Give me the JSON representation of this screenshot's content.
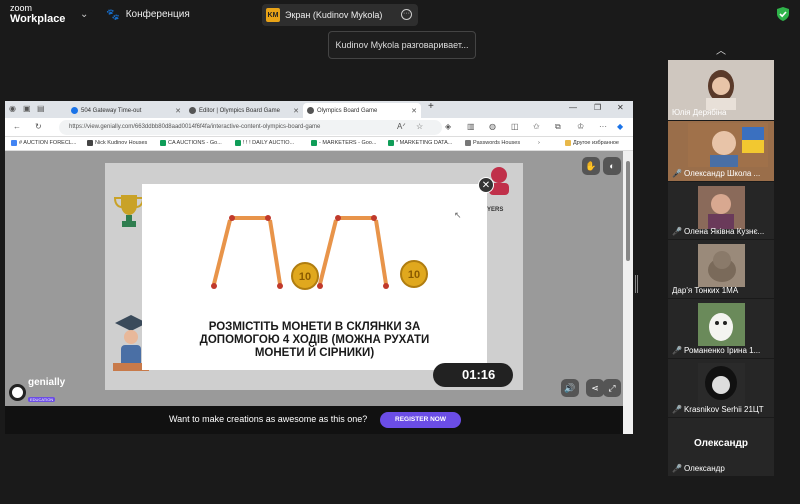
{
  "zoom": {
    "brand_line1": "zoom",
    "brand_line2": "Workplace",
    "meeting_title": "Конференция",
    "share_badge": "KM",
    "share_label": "Экран (Kudinov Mykola)",
    "talking_indicator": "Kudinov Mykola разговаривает..."
  },
  "browser": {
    "tabs": [
      {
        "label": "504 Gateway Time-out"
      },
      {
        "label": "Editor | Olympics Board Game"
      },
      {
        "label": "Olympics Board Game"
      }
    ],
    "url": "https://view.genially.com/663ddbb80d8aad0014f6f4fa/interactive-content-olympics-board-game",
    "bookmarks": [
      {
        "label": "# AUCTION FORECL..."
      },
      {
        "label": "Nick Kudinov Houses"
      },
      {
        "label": "CA AUCTIONS - Go..."
      },
      {
        "label": "! ! ! DAILY AUCTIO..."
      },
      {
        "label": "- MARKETERS - Goo..."
      },
      {
        "label": "* MARKETING DATA..."
      },
      {
        "label": "Passwords Houses"
      },
      {
        "label": "Другое избранное"
      }
    ]
  },
  "game": {
    "modal_text_line1": "РОЗМІСТІТЬ МОНЕТИ В СКЛЯНКИ ЗА",
    "modal_text_line2": "ДОПОМОГОЮ 4 ХОДІВ (МОЖНА РУХАТИ",
    "modal_text_line3": "МОНЕТИ Й СІРНИКИ)",
    "coin_value": "10",
    "timer": "01:16",
    "side_label": "YERS",
    "brand": "genially",
    "brand_tag": "EDUCATION",
    "cta_text": "Want to make creations as awesome as this one?",
    "cta_button": "REGISTER NOW"
  },
  "participants": [
    {
      "name": "Юлія Дерябіна",
      "muted": false
    },
    {
      "name": "Олександр Школа ...",
      "muted": true
    },
    {
      "name": "Олена Яківна Кузнє...",
      "muted": true
    },
    {
      "name": "Дар'я Тонких 1МА",
      "muted": false
    },
    {
      "name": "Романенко Ірина 1...",
      "muted": true
    },
    {
      "name": "Krasnikov Serhii 21ЦТ",
      "muted": true
    },
    {
      "name": "Олександр",
      "muted": true,
      "display_name": "Олександр"
    }
  ],
  "colors": {
    "zoom_bg": "#1a1a1a",
    "genially_purple": "#6b4de6",
    "coin_gold": "#e0a81e",
    "match_wood": "#e8944a",
    "match_head": "#c0392b",
    "mute_red": "#e5393a"
  }
}
